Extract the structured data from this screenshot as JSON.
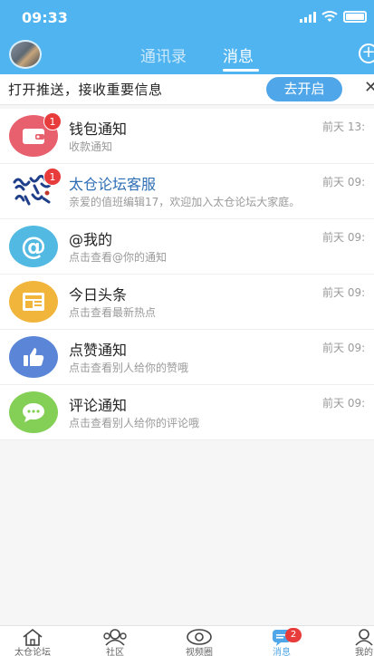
{
  "status_bar": {
    "time": "09:33"
  },
  "tabs": [
    {
      "label": "通讯录",
      "active": false
    },
    {
      "label": "消息",
      "active": true
    }
  ],
  "push_banner": {
    "text": "打开推送，接收重要信息",
    "button_label": "去开启",
    "close_icon": "close-icon"
  },
  "messages": [
    {
      "title": "钱包通知",
      "subtitle": "收款通知",
      "time": "前天 13:",
      "badge": "1",
      "icon": "wallet-icon",
      "color": "#e8606e"
    },
    {
      "title": "太仓论坛客服",
      "subtitle": "亲爱的值班编辑17，欢迎加入太仓论坛大家庭。",
      "time": "前天 09:",
      "badge": "1",
      "icon": "forum-logo",
      "color": "#2e6fb4"
    },
    {
      "title": "@我的",
      "subtitle": "点击查看@你的通知",
      "time": "前天 09:",
      "icon": "at-icon",
      "color": "#52b9e3"
    },
    {
      "title": "今日头条",
      "subtitle": "点击查看最新热点",
      "time": "前天 09:",
      "icon": "news-icon",
      "color": "#f1b53c"
    },
    {
      "title": "点赞通知",
      "subtitle": "点击查看别人给你的赞哦",
      "time": "前天 09:",
      "icon": "thumbs-up-icon",
      "color": "#5b86d8"
    },
    {
      "title": "评论通知",
      "subtitle": "点击查看别人给你的评论哦",
      "time": "前天 09:",
      "icon": "comment-icon",
      "color": "#84cf56"
    }
  ],
  "bottom_nav": [
    {
      "label": "太仓论坛",
      "icon": "home-icon"
    },
    {
      "label": "社区",
      "icon": "community-icon"
    },
    {
      "label": "视频圈",
      "icon": "video-icon"
    },
    {
      "label": "消息",
      "icon": "message-icon",
      "badge": "2",
      "active": true
    },
    {
      "label": "我的",
      "icon": "profile-icon"
    }
  ]
}
